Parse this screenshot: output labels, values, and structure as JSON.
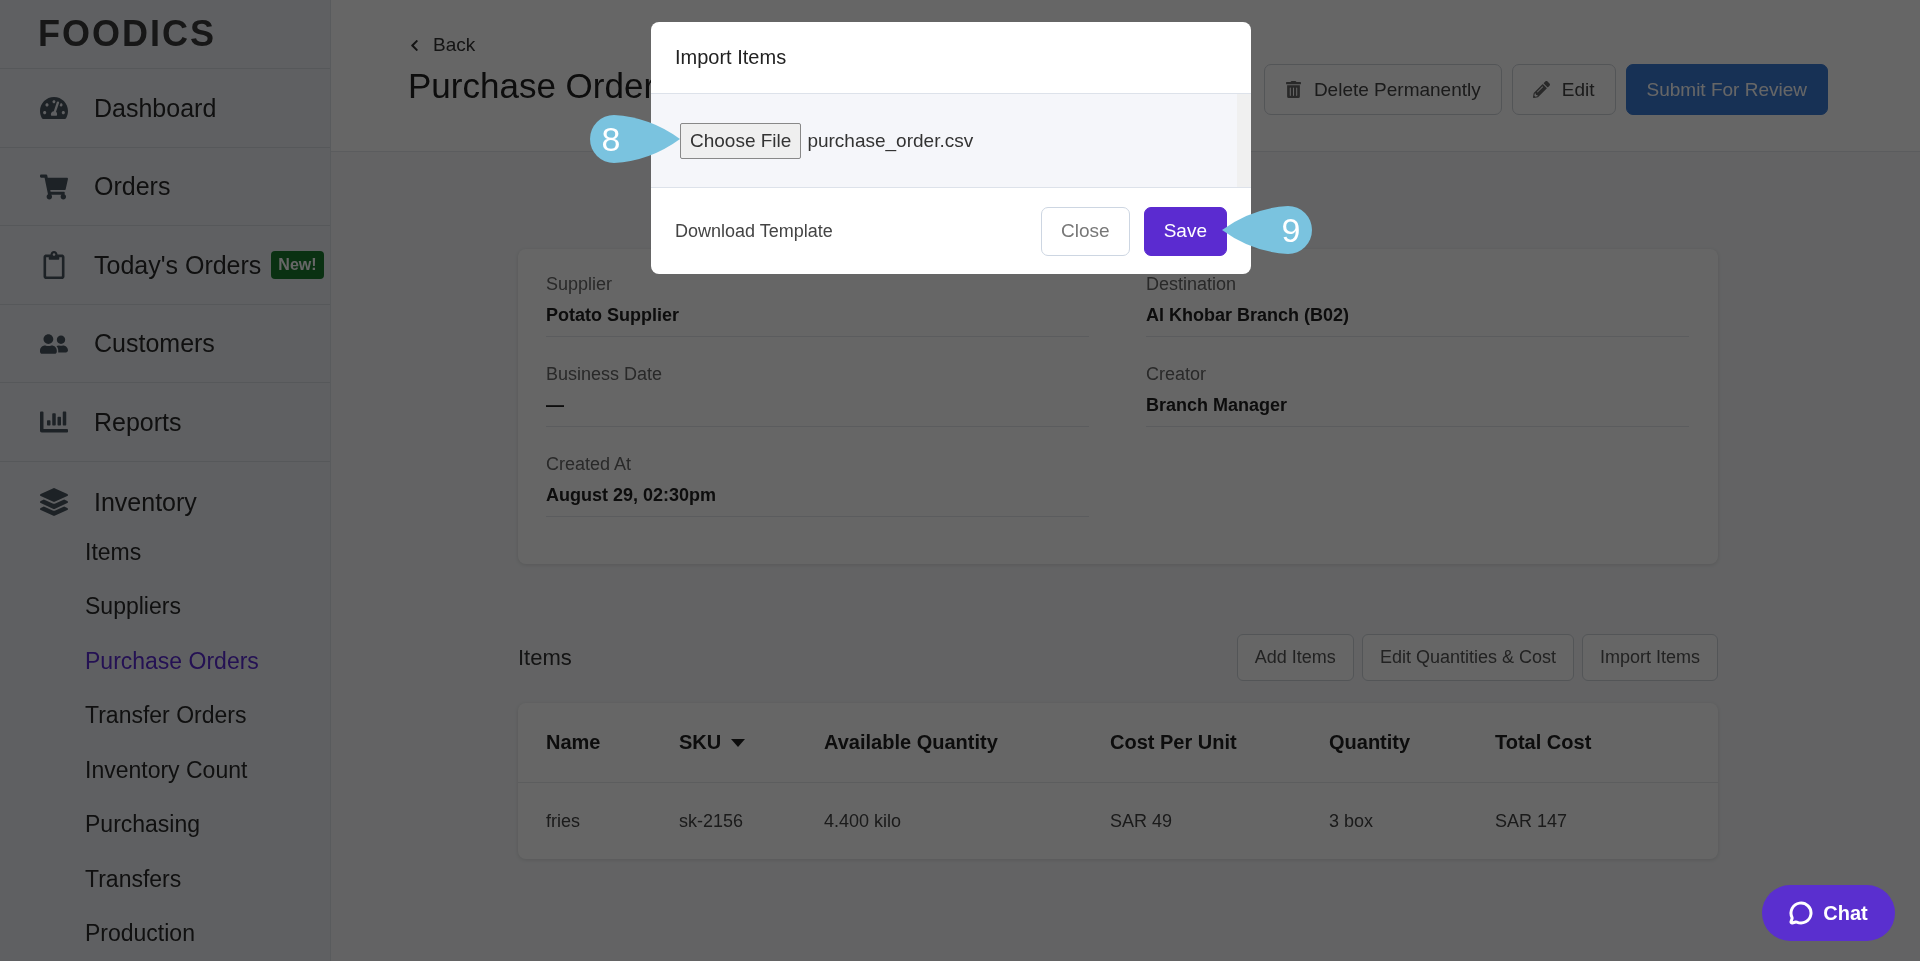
{
  "logo": "FOODICS",
  "sidebar": {
    "items": [
      {
        "label": "Dashboard",
        "selected": false
      },
      {
        "label": "Orders",
        "selected": false
      },
      {
        "label": "Today's Orders",
        "badge": "New!",
        "selected": false
      },
      {
        "label": "Customers",
        "selected": false
      },
      {
        "label": "Reports",
        "selected": false
      },
      {
        "label": "Inventory",
        "selected": false,
        "children": [
          {
            "label": "Items",
            "selected": false
          },
          {
            "label": "Suppliers",
            "selected": false
          },
          {
            "label": "Purchase Orders",
            "selected": true
          },
          {
            "label": "Transfer Orders",
            "selected": false
          },
          {
            "label": "Inventory Count",
            "selected": false
          },
          {
            "label": "Purchasing",
            "selected": false
          },
          {
            "label": "Transfers",
            "selected": false
          },
          {
            "label": "Production",
            "selected": false
          }
        ]
      }
    ]
  },
  "header": {
    "back": "Back",
    "title": "Purchase Order",
    "buttons": [
      {
        "label": "Delete Permanently",
        "kind": "delete"
      },
      {
        "label": "Edit",
        "kind": "edit"
      },
      {
        "label": "Submit For Review",
        "kind": "primary"
      }
    ]
  },
  "details": [
    {
      "label": "Supplier",
      "value": "Potato Supplier"
    },
    {
      "label": "Destination",
      "value": "Al Khobar Branch (B02)"
    },
    {
      "label": "Business Date",
      "value": "—"
    },
    {
      "label": "Creator",
      "value": "Branch Manager"
    },
    {
      "label": "Created At",
      "value": "August 29, 02:30pm"
    }
  ],
  "items": {
    "title": "Items",
    "buttons": [
      "Add Items",
      "Edit Quantities & Cost",
      "Import Items"
    ],
    "columns": [
      {
        "label": "Name",
        "sorted": false
      },
      {
        "label": "SKU",
        "sorted": true
      },
      {
        "label": "Available Quantity",
        "sorted": false
      },
      {
        "label": "Cost Per Unit",
        "sorted": false
      },
      {
        "label": "Quantity",
        "sorted": false
      },
      {
        "label": "Total Cost",
        "sorted": false
      }
    ],
    "rows": [
      [
        "fries",
        "sk-2156",
        "4.400 kilo",
        "SAR 49",
        "3 box",
        "SAR 147"
      ]
    ]
  },
  "modal": {
    "title": "Import Items",
    "file_button": "Choose File",
    "file_name": "purchase_order.csv",
    "link": "Download Template",
    "buttons": [
      {
        "label": "Close",
        "kind": "secondary"
      },
      {
        "label": "Save",
        "kind": "primary"
      }
    ]
  },
  "callouts": [
    {
      "label": "8",
      "kind": "right"
    },
    {
      "label": "9",
      "kind": "left"
    }
  ],
  "chat": {
    "label": "Chat"
  }
}
